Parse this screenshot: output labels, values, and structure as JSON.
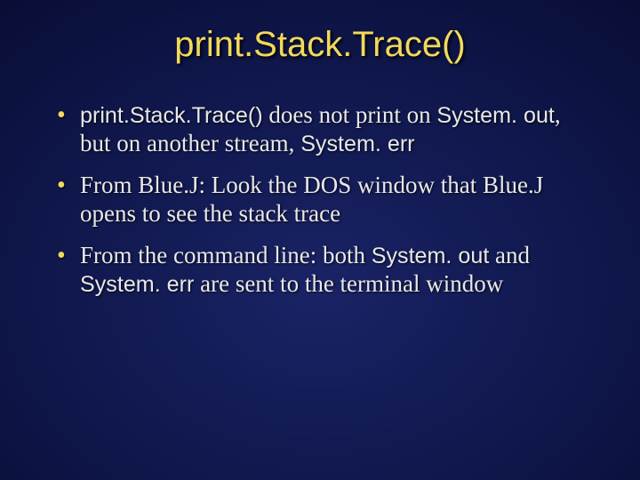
{
  "title": "print.Stack.Trace()",
  "bullets": {
    "b1": {
      "p1": "print.Stack.Trace()",
      "p2": " does not print on ",
      "p3": "System. out",
      "p4": ", but on another stream, ",
      "p5": "System. err"
    },
    "b2": "From Blue.J: Look the DOS window that Blue.J opens to see the stack trace",
    "b3": {
      "p1": "From the command line: both ",
      "p2": "System. out",
      "p3": " and ",
      "p4": "System. err",
      "p5": " are sent to the terminal window"
    }
  }
}
